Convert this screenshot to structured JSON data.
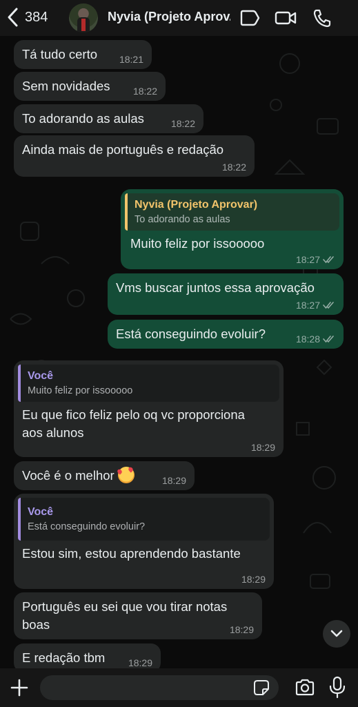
{
  "header": {
    "back_count": "384",
    "contact_name": "Nyvia (Projeto Aprov..."
  },
  "messages": [
    {
      "dir": "in",
      "text": "Tá tudo certo",
      "time": "18:21"
    },
    {
      "dir": "in",
      "text": "Sem novidades",
      "time": "18:22"
    },
    {
      "dir": "in",
      "text": "To adorando as aulas",
      "time": "18:22"
    },
    {
      "dir": "in",
      "text": "Ainda mais de português e redação",
      "time": "18:22"
    },
    {
      "dir": "out",
      "quote_name": "Nyvia (Projeto Aprovar)",
      "quote_text": "To adorando as aulas",
      "text": "Muito feliz por issooooo",
      "time": "18:27"
    },
    {
      "dir": "out",
      "text": "Vms buscar juntos essa aprovação",
      "time": "18:27"
    },
    {
      "dir": "out",
      "text": "Está conseguindo evoluir?",
      "time": "18:28"
    },
    {
      "dir": "in",
      "quote_name": "Você",
      "quote_text": "Muito feliz por issooooo",
      "text_line1": "Eu que fico feliz pelo oq vc proporciona",
      "text_line2": "aos alunos",
      "time": "18:29"
    },
    {
      "dir": "in",
      "text": "Você é o melhor",
      "emoji": "smiling-face-with-hearts",
      "time": "18:29"
    },
    {
      "dir": "in",
      "quote_name": "Você",
      "quote_text": "Está conseguindo evoluir?",
      "text": "Estou sim, estou aprendendo bastante",
      "time": "18:29"
    },
    {
      "dir": "in",
      "text_line1": "Português eu sei que vou tirar notas",
      "text_line2": "boas",
      "time": "18:29"
    },
    {
      "dir": "in",
      "text": "E redação tbm",
      "time": "18:29"
    }
  ],
  "composer": {
    "input_value": ""
  },
  "colors": {
    "incoming_bubble": "#242626",
    "outgoing_bubble": "#144d37",
    "quote_bar_outgoing": "#f2c46b",
    "quote_bar_incoming": "#a28ce0"
  }
}
